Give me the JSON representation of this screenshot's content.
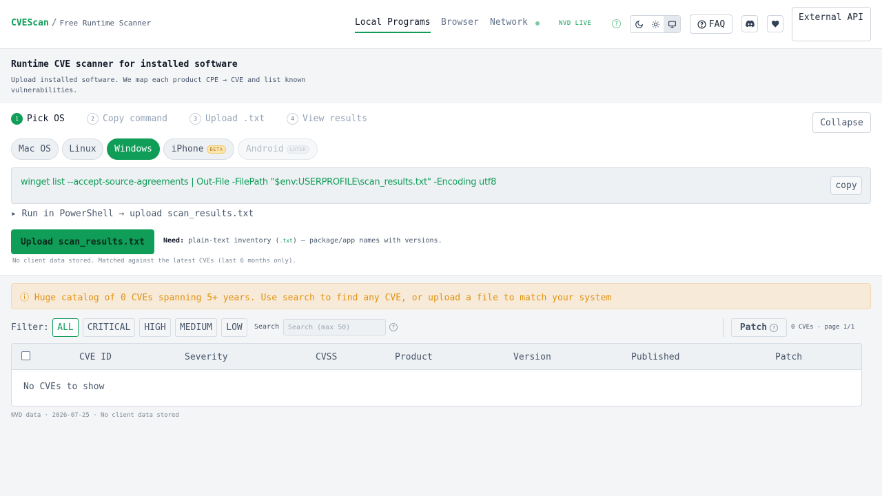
{
  "header": {
    "brand": "CVEScan",
    "separator": "/",
    "subtitle": "Free Runtime Scanner",
    "tabs": [
      {
        "label": "Local Programs",
        "active": true
      },
      {
        "label": "Browser",
        "active": false
      },
      {
        "label": "Network",
        "active": false
      }
    ],
    "live_label": "NVD LIVE",
    "help_glyph": "?",
    "faq_label": "FAQ",
    "external_api_label": "External API",
    "accent_color": "#0f9d58"
  },
  "intro": {
    "title": "Runtime CVE scanner for installed software",
    "description": "Upload installed software. We map each product CPE → CVE and list known vulnerabilities."
  },
  "wizard": {
    "steps": [
      {
        "num": "1",
        "label": "Pick OS",
        "active": true
      },
      {
        "num": "2",
        "label": "Copy command",
        "active": false
      },
      {
        "num": "3",
        "label": "Upload .txt",
        "active": false
      },
      {
        "num": "4",
        "label": "View results",
        "active": false
      }
    ],
    "collapse_label": "Collapse",
    "os_options": [
      {
        "label": "Mac OS",
        "state": "normal"
      },
      {
        "label": "Linux",
        "state": "normal"
      },
      {
        "label": "Windows",
        "state": "active"
      },
      {
        "label": "iPhone",
        "state": "normal",
        "badge": "BETA"
      },
      {
        "label": "Android",
        "state": "disabled",
        "badge": "LATER"
      }
    ],
    "command": "winget list --accept-source-agreements | Out-File -FilePath \"$env:USERPROFILE\\scan_results.txt\" -Encoding utf8",
    "copy_label": "copy",
    "run_hint": "▸ Run in PowerShell → upload scan_results.txt",
    "upload_label": "Upload scan_results.txt",
    "need_label": "Need:",
    "need_text_pre": " plain-text inventory (",
    "need_ext": ".txt",
    "need_text_post": ") — package/app names with versions.",
    "no_store_text": "No client data stored. Matched against the latest CVEs (last 6 months only)."
  },
  "banner": {
    "text": "ⓘ Huge catalog of 0 CVEs spanning 5+ years. Use search to find any CVE, or upload a file to match your system"
  },
  "filters": {
    "label": "Filter:",
    "chips": [
      {
        "label": "ALL",
        "active": true
      },
      {
        "label": "CRITICAL",
        "active": false
      },
      {
        "label": "HIGH",
        "active": false
      },
      {
        "label": "MEDIUM",
        "active": false
      },
      {
        "label": "LOW",
        "active": false
      }
    ],
    "search_label": "Search",
    "search_placeholder": "Search (max 50)",
    "search_value": "",
    "patch_label": "Patch",
    "page_info": "0 CVEs · page 1/1"
  },
  "table": {
    "columns": [
      "CVE ID",
      "Severity",
      "CVSS",
      "Product",
      "Version",
      "Published",
      "Patch"
    ],
    "rows": [],
    "empty_text": "No CVEs to show"
  },
  "footer": {
    "text": "NVD data · 2026-07-25 · No client data stored"
  }
}
